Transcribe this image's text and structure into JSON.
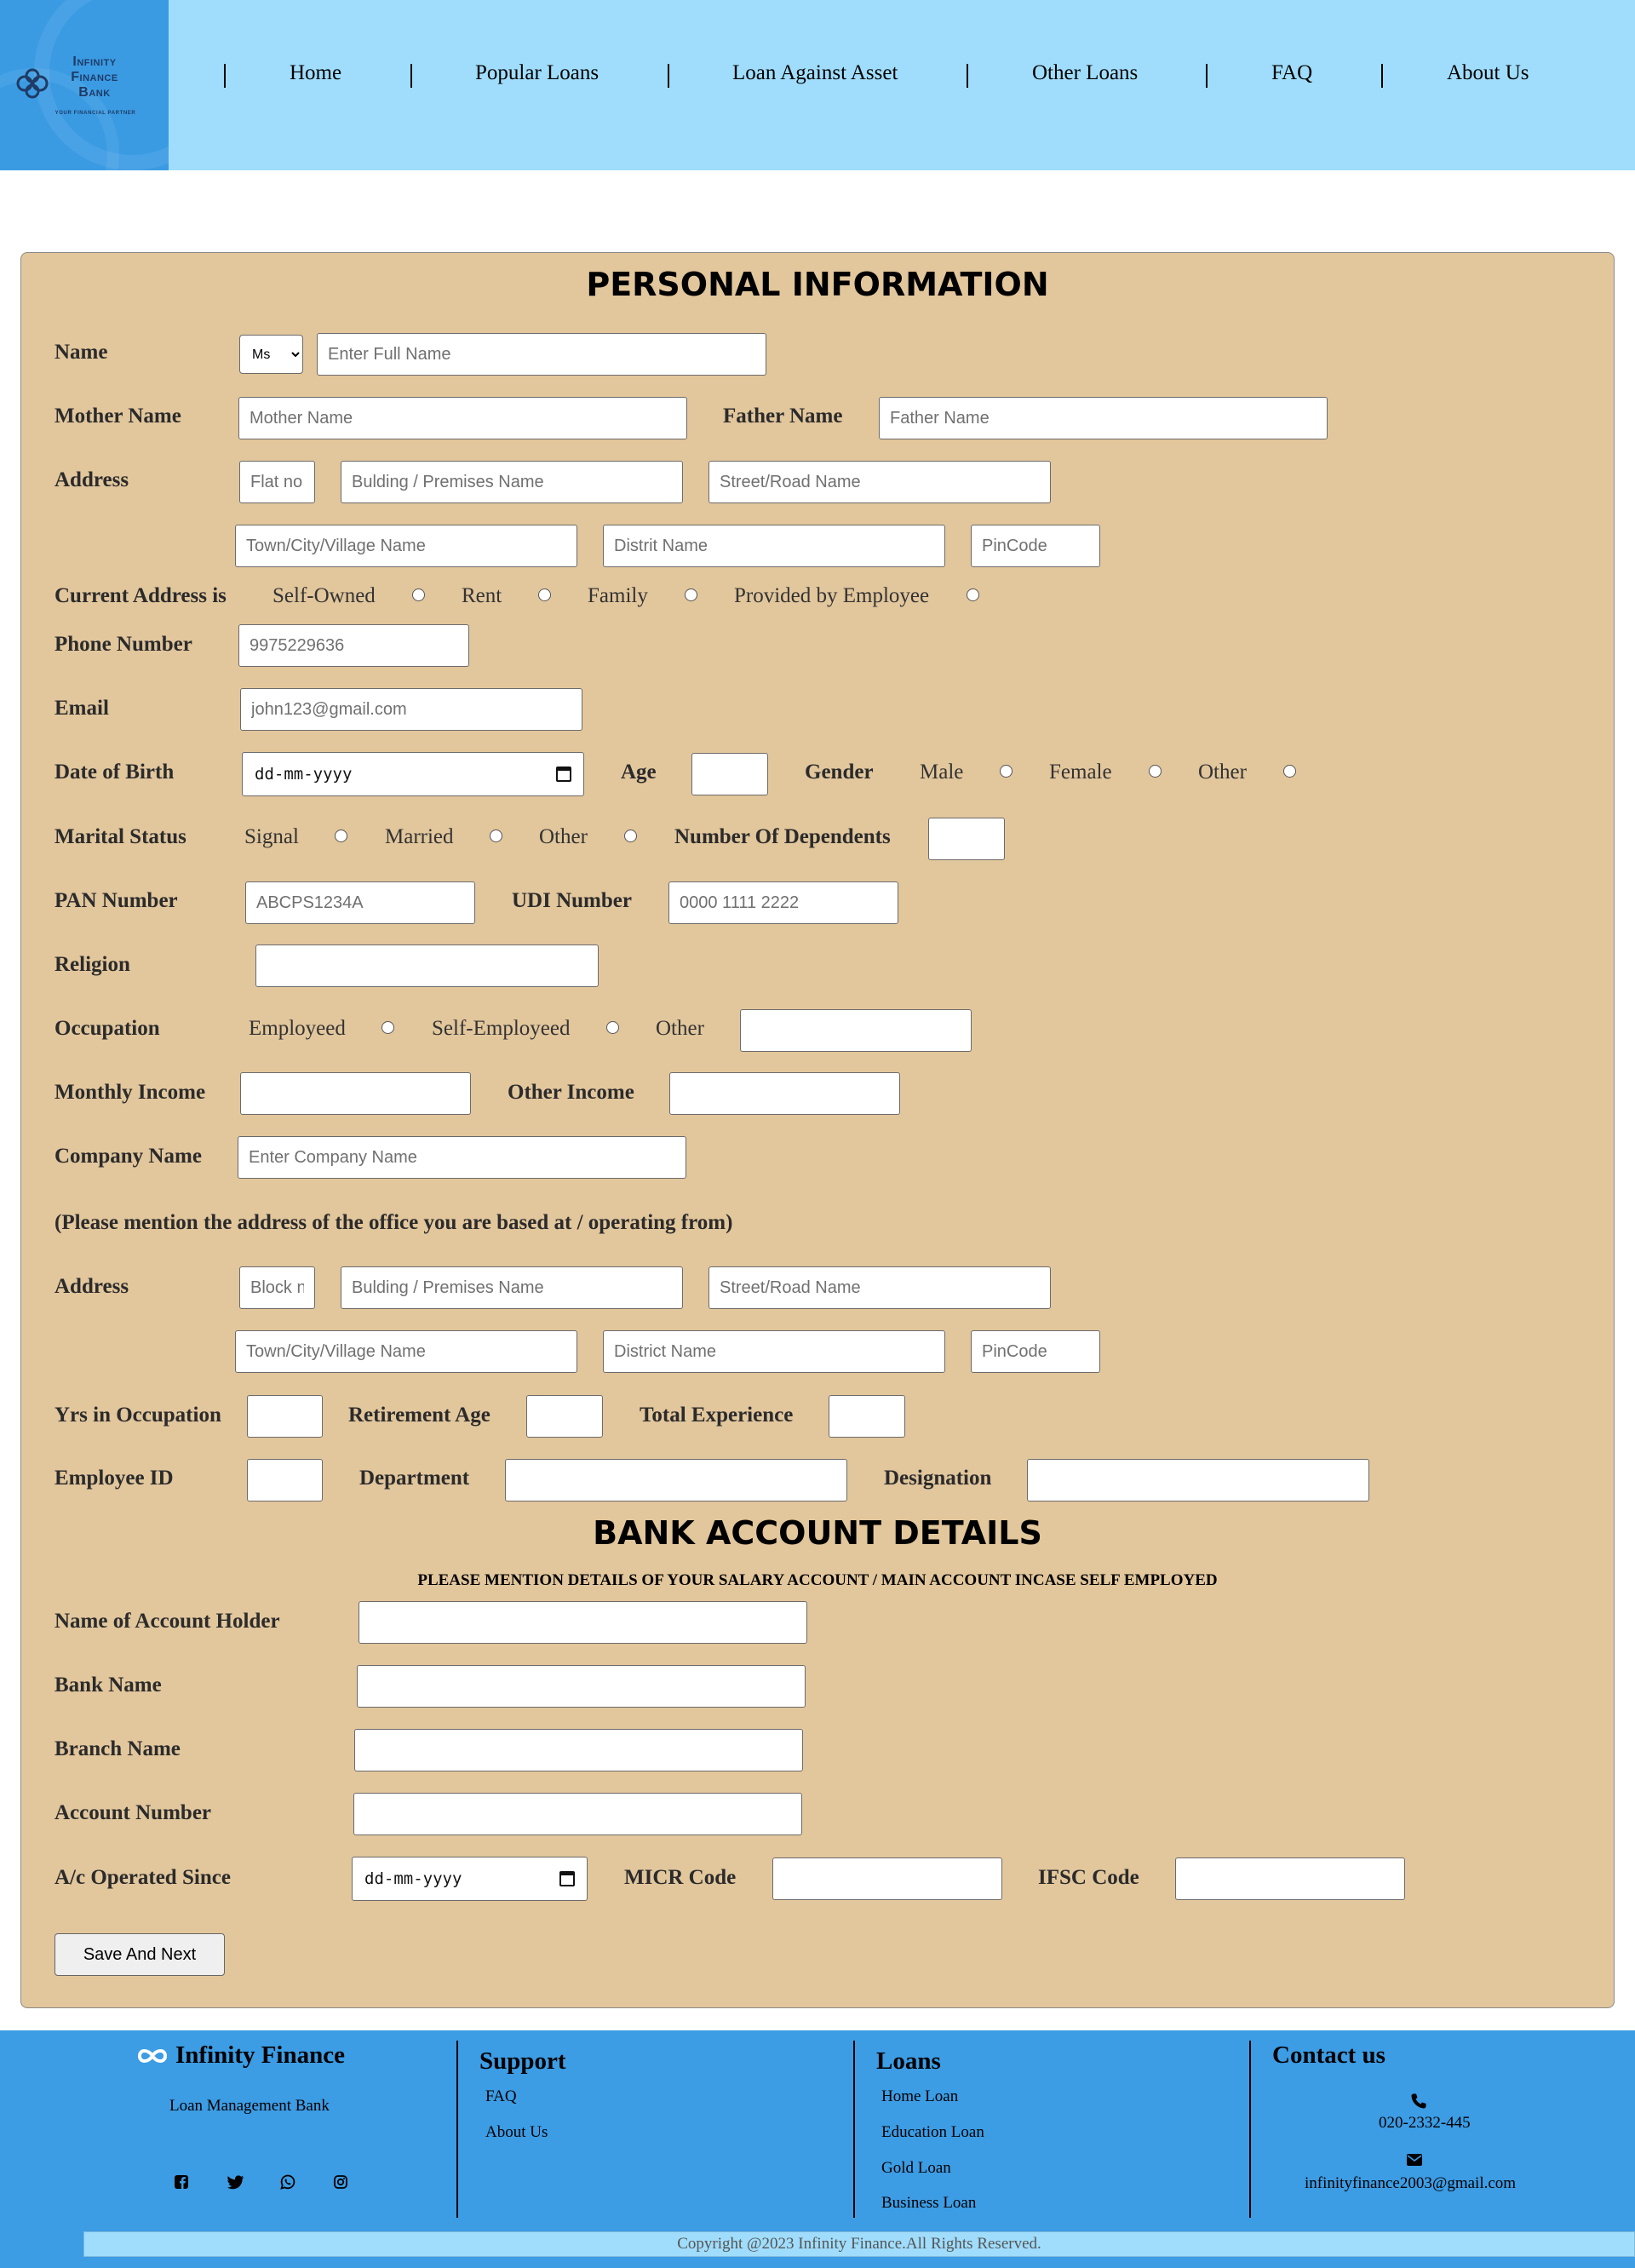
{
  "brand": {
    "logo_line1": "Infinity",
    "logo_line2": "Finance",
    "logo_line3": "Bank",
    "logo_tagline": "YOUR FINANCIAL PARTNER"
  },
  "nav": {
    "items": [
      "Home",
      "Popular Loans",
      "Loan Against Asset",
      "Other Loans",
      "FAQ",
      "About Us"
    ]
  },
  "personal": {
    "title": "PERSONAL INFORMATION",
    "name_label": "Name",
    "salutation_value": "Ms",
    "name_placeholder": "Enter Full Name",
    "mother_label": "Mother Name",
    "mother_placeholder": "Mother Name",
    "father_label": "Father Name",
    "father_placeholder": "Father Name",
    "address_label": "Address",
    "flat_placeholder": "Flat no",
    "building_placeholder": "Bulding / Premises Name",
    "street_placeholder": "Street/Road Name",
    "town_placeholder": "Town/City/Village Name",
    "district_placeholder": "Distrit Name",
    "pincode_placeholder": "PinCode",
    "current_address_label": "Current Address is",
    "current_address_options": [
      "Self-Owned",
      "Rent",
      "Family",
      "Provided by Employee"
    ],
    "phone_label": "Phone Number",
    "phone_placeholder": "9975229636",
    "email_label": "Email",
    "email_placeholder": "john123@gmail.com",
    "dob_label": "Date of Birth",
    "dob_value": "dd-mm-yyyy",
    "age_label": "Age",
    "gender_label": "Gender",
    "gender_options": [
      "Male",
      "Female",
      "Other"
    ],
    "marital_label": "Marital Status",
    "marital_options": [
      "Signal",
      "Married",
      "Other"
    ],
    "dependents_label": "Number Of Dependents",
    "pan_label": "PAN Number",
    "pan_placeholder": "ABCPS1234A",
    "udi_label": "UDI Number",
    "udi_placeholder": "0000 1111 2222",
    "religion_label": "Religion",
    "occupation_label": "Occupation",
    "occupation_options": [
      "Employeed",
      "Self-Employeed",
      "Other"
    ],
    "monthly_income_label": "Monthly Income",
    "other_income_label": "Other Income",
    "company_label": "Company Name",
    "company_placeholder": "Enter Company Name",
    "office_note": "(Please mention the address of the office you are based at / operating from)",
    "office_address_label": "Address",
    "block_placeholder": "Block no",
    "office_building_placeholder": "Bulding / Premises Name",
    "office_street_placeholder": "Street/Road Name",
    "office_town_placeholder": "Town/City/Village Name",
    "office_district_placeholder": "District Name",
    "office_pincode_placeholder": "PinCode",
    "yrs_occupation_label": "Yrs in Occupation",
    "retirement_label": "Retirement Age",
    "total_exp_label": "Total Experience",
    "employee_id_label": "Employee ID",
    "department_label": "Department",
    "designation_label": "Designation"
  },
  "bank": {
    "title": "BANK ACCOUNT DETAILS",
    "subtitle": "PLEASE MENTION DETAILS OF YOUR SALARY ACCOUNT / MAIN ACCOUNT INCASE SELF EMPLOYED",
    "holder_label": "Name of Account Holder",
    "bank_name_label": "Bank Name",
    "branch_label": "Branch Name",
    "account_label": "Account Number",
    "operated_since_label": "A/c Operated Since",
    "operated_since_value": "dd-mm-yyyy",
    "micr_label": "MICR Code",
    "ifsc_label": "IFSC Code",
    "save_button": "Save And Next"
  },
  "footer": {
    "brand_name": "Infinity Finance",
    "brand_tagline": "Loan Management Bank",
    "support_title": "Support",
    "support_links": [
      "FAQ",
      "About Us"
    ],
    "loans_title": "Loans",
    "loans_links": [
      "Home Loan",
      "Education Loan",
      "Gold Loan",
      "Business Loan"
    ],
    "contact_title": "Contact us",
    "phone": "020-2332-445",
    "email": "infinityfinance2003@gmail.com",
    "copyright": "Copyright @2023 Infinity Finance.All Rights Reserved.",
    "social_icons": [
      "facebook-icon",
      "twitter-icon",
      "whatsapp-icon",
      "instagram-icon"
    ]
  },
  "colors": {
    "header_bg": "#a0ddfc",
    "logo_bg": "#3a9be3",
    "panel_bg": "#e2c69c",
    "footer_bg": "#3c9ce4"
  }
}
